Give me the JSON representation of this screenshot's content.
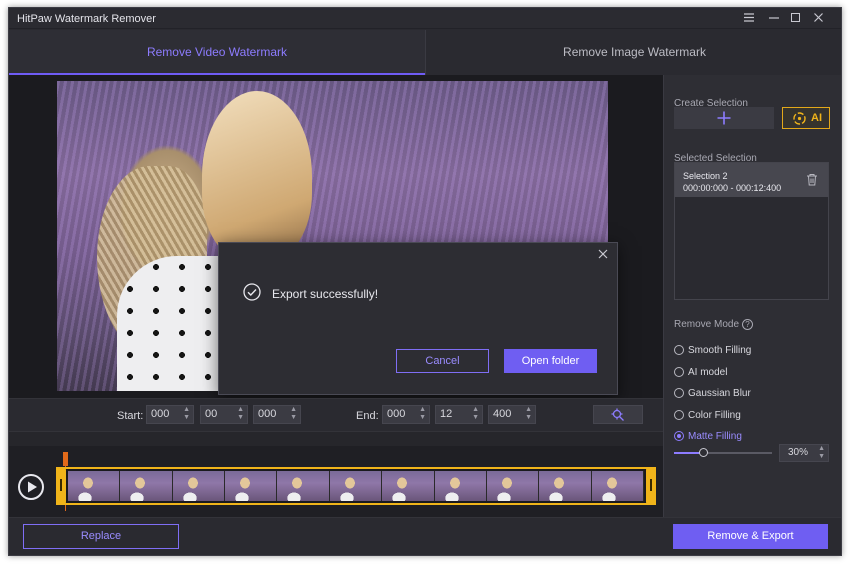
{
  "window": {
    "title": "HitPaw Watermark Remover"
  },
  "tabs": [
    {
      "label": "Remove Video Watermark",
      "active": true
    },
    {
      "label": "Remove Image Watermark",
      "active": false
    }
  ],
  "dialog": {
    "message": "Export successfully!",
    "cancel_label": "Cancel",
    "open_label": "Open folder"
  },
  "time": {
    "start_label": "Start:",
    "start": [
      "000",
      "00",
      "000"
    ],
    "end_label": "End:",
    "end": [
      "000",
      "12",
      "400"
    ]
  },
  "panel": {
    "create_selection": "Create Selection",
    "ai_label": "AI",
    "selected_selection": "Selected Selection",
    "selection_item": {
      "name": "Selection 2",
      "time": "000:00:000 - 000:12:400"
    },
    "remove_mode": "Remove Mode",
    "modes": [
      {
        "label": "Smooth Filling",
        "selected": false
      },
      {
        "label": "AI model",
        "selected": false
      },
      {
        "label": "Gaussian Blur",
        "selected": false
      },
      {
        "label": "Color Filling",
        "selected": false
      },
      {
        "label": "Matte Filling",
        "selected": true
      }
    ],
    "matte_percent": "30%",
    "matte_level": 0.3
  },
  "bottom": {
    "replace_label": "Replace",
    "export_label": "Remove & Export"
  },
  "colors": {
    "accent": "#6f5ef2",
    "selection": "#f0b41a",
    "playhead": "#e26a1a"
  }
}
